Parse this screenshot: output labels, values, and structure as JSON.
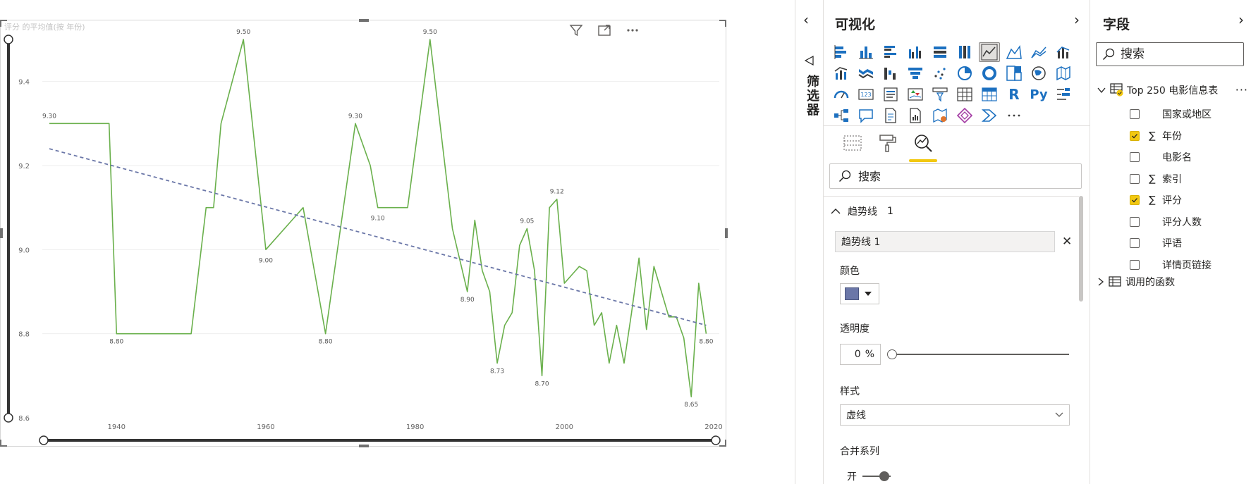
{
  "canvas": {
    "chart_title": "评分 的平均值(按 年份)",
    "header_icons": [
      "filter-icon",
      "focus-mode-icon",
      "more-options-icon"
    ]
  },
  "chart_data": {
    "type": "line",
    "title": "评分 的平均值(按 年份)",
    "xlabel": "",
    "ylabel": "",
    "x_ticks": [
      "1940",
      "1960",
      "1980",
      "2000",
      "2020"
    ],
    "y_ticks": [
      "8.6",
      "8.8",
      "9.0",
      "9.2",
      "9.4"
    ],
    "xlim": [
      1931,
      2020
    ],
    "ylim": [
      8.6,
      9.5
    ],
    "grid": true,
    "series": [
      {
        "color": "#6ab04c",
        "x": [
          1931,
          1939,
          1940,
          1950,
          1952,
          1953,
          1954,
          1957,
          1960,
          1964,
          1965,
          1968,
          1972,
          1974,
          1975,
          1979,
          1982,
          1985,
          1987,
          1988,
          1989,
          1990,
          1991,
          1992,
          1993,
          1994,
          1995,
          1996,
          1997,
          1998,
          1999,
          2000,
          2001,
          2002,
          2003,
          2004,
          2005,
          2006,
          2007,
          2008,
          2009,
          2010,
          2011,
          2012,
          2013,
          2014,
          2015,
          2016,
          2017,
          2018,
          2019
        ],
        "y": [
          9.3,
          9.3,
          8.8,
          8.8,
          9.1,
          9.1,
          9.3,
          9.5,
          9.0,
          9.08,
          9.1,
          8.8,
          9.3,
          9.2,
          9.1,
          9.1,
          9.5,
          9.05,
          8.9,
          9.07,
          8.95,
          8.9,
          8.73,
          8.82,
          8.85,
          9.01,
          9.05,
          8.95,
          8.7,
          9.1,
          9.12,
          8.92,
          8.94,
          8.96,
          8.95,
          8.82,
          8.85,
          8.73,
          8.82,
          8.73,
          8.85,
          8.98,
          8.81,
          8.96,
          8.9,
          8.84,
          8.84,
          8.79,
          8.65,
          8.92,
          8.8
        ]
      }
    ],
    "trendline": {
      "style": "dashed",
      "color": "#6b77a8",
      "start": [
        1931,
        9.24
      ],
      "end": [
        2019,
        8.82
      ]
    },
    "data_labels": [
      {
        "x": 1931,
        "y": 9.3,
        "text": "9.30"
      },
      {
        "x": 1940,
        "y": 8.8,
        "text": "8.80"
      },
      {
        "x": 1957,
        "y": 9.5,
        "text": "9.50"
      },
      {
        "x": 1960,
        "y": 9.0,
        "text": "9.00"
      },
      {
        "x": 1968,
        "y": 8.8,
        "text": "8.80"
      },
      {
        "x": 1972,
        "y": 9.3,
        "text": "9.30"
      },
      {
        "x": 1975,
        "y": 9.1,
        "text": "9.10"
      },
      {
        "x": 1982,
        "y": 9.5,
        "text": "9.50"
      },
      {
        "x": 1987,
        "y": 8.9,
        "text": "8.90"
      },
      {
        "x": 1991,
        "y": 8.73,
        "text": "8.73"
      },
      {
        "x": 1995,
        "y": 9.05,
        "text": "9.05"
      },
      {
        "x": 1997,
        "y": 8.7,
        "text": "8.70"
      },
      {
        "x": 1999,
        "y": 9.12,
        "text": "9.12"
      },
      {
        "x": 2017,
        "y": 8.65,
        "text": "8.65"
      },
      {
        "x": 2019,
        "y": 8.8,
        "text": "8.80"
      }
    ]
  },
  "filter_rail": {
    "label": "筛选器"
  },
  "viz_pane": {
    "title": "可视化",
    "icons": [
      "stacked-bar-icon",
      "stacked-column-icon",
      "clustered-bar-icon",
      "clustered-column-icon",
      "100-stacked-bar-icon",
      "100-stacked-column-icon",
      "line-chart-icon",
      "area-chart-icon",
      "stacked-area-icon",
      "line-clustered-column-icon",
      "line-stacked-column-icon",
      "ribbon-chart-icon",
      "waterfall-icon",
      "funnel-icon",
      "scatter-icon",
      "pie-icon",
      "donut-icon",
      "treemap-icon",
      "map-icon",
      "filled-map-icon",
      "gauge-icon",
      "card-icon",
      "multi-row-card-icon",
      "kpi-icon",
      "slicer-icon",
      "table-icon",
      "matrix-icon",
      "r-visual-icon",
      "python-visual-icon",
      "key-influencers-icon",
      "decomposition-tree-icon",
      "qa-icon",
      "smart-narrative-icon",
      "paginated-report-icon",
      "arcgis-icon",
      "power-apps-icon",
      "power-automate-icon",
      "more-visuals-icon"
    ],
    "r_label": "R",
    "py_label": "Py",
    "search_placeholder": "搜索",
    "section_title": "趋势线",
    "section_count": "1",
    "trend_item": "趋势线 1",
    "color_label": "颜色",
    "color_value": "#6b77a8",
    "opacity_label": "透明度",
    "opacity_value": "0",
    "opacity_unit": "%",
    "opacity_fraction": 0,
    "style_label": "样式",
    "style_value": "虚线",
    "combine_label": "合并系列",
    "combine_toggle": "开"
  },
  "fields_pane": {
    "title": "字段",
    "search_placeholder": "搜索",
    "table_name": "Top 250 电影信息表",
    "fields": [
      {
        "name": "国家或地区",
        "checked": false,
        "sigma": false
      },
      {
        "name": "年份",
        "checked": true,
        "sigma": true
      },
      {
        "name": "电影名",
        "checked": false,
        "sigma": false
      },
      {
        "name": "索引",
        "checked": false,
        "sigma": true
      },
      {
        "name": "评分",
        "checked": true,
        "sigma": true
      },
      {
        "name": "评分人数",
        "checked": false,
        "sigma": false
      },
      {
        "name": "评语",
        "checked": false,
        "sigma": false
      },
      {
        "name": "详情页链接",
        "checked": false,
        "sigma": false
      }
    ],
    "second_table": "调用的函数"
  },
  "colors": {
    "accent": "#f2c811",
    "line": "#6ab04c",
    "trend": "#6b77a8"
  }
}
